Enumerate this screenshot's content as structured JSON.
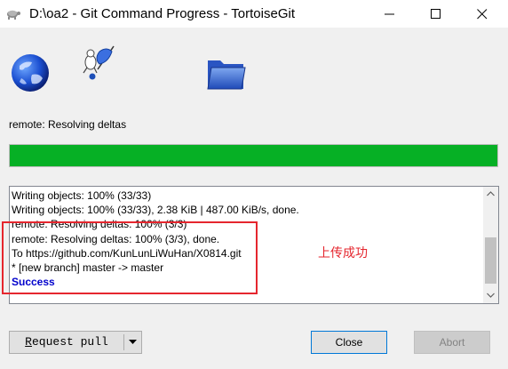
{
  "window": {
    "title": "D:\\oa2 - Git Command Progress - TortoiseGit",
    "app_icon": "tortoise-icon"
  },
  "animation": {
    "icons": [
      "globe-icon",
      "tortoise-flag-icon",
      "folder-icon"
    ]
  },
  "status": {
    "label": "remote: Resolving deltas"
  },
  "progress": {
    "percent": 100,
    "color": "#06b025"
  },
  "log": {
    "lines": [
      "Writing objects: 100% (33/33)",
      "Writing objects: 100% (33/33), 2.38 KiB | 487.00 KiB/s, done.",
      "remote: Resolving deltas: 100% (3/3)",
      "remote: Resolving deltas: 100% (3/3), done.",
      "To https://github.com/KunLunLiWuHan/X0814.git",
      "* [new branch]      master -> master",
      "Success"
    ],
    "success_color": "#0000cc"
  },
  "annotation": {
    "text": "上传成功",
    "color": "#e5262e"
  },
  "buttons": {
    "request_pull_first": "R",
    "request_pull_rest": "equest pull",
    "close": "Close",
    "abort": "Abort"
  }
}
